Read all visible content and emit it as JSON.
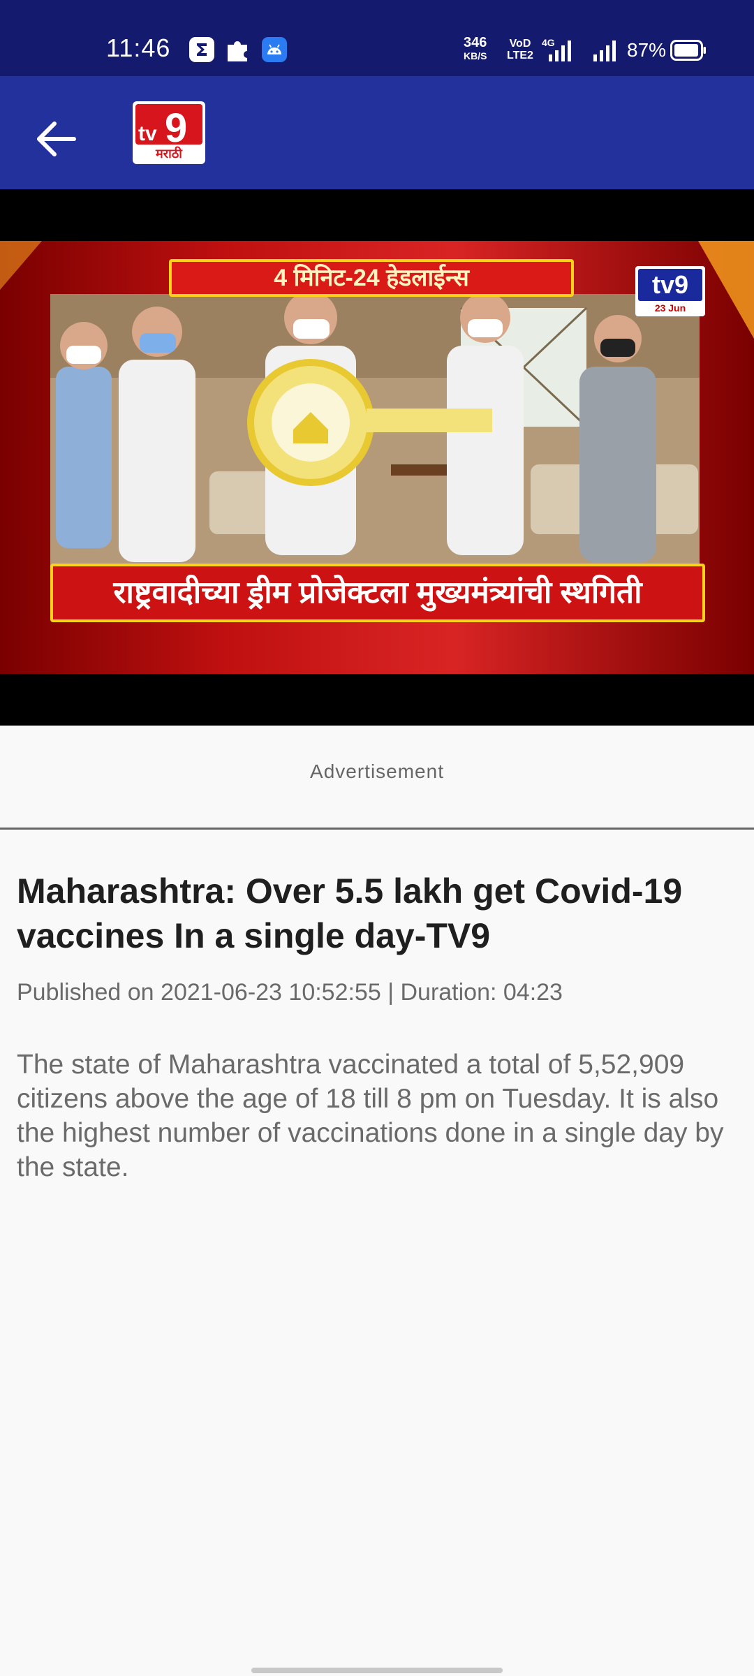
{
  "status_bar": {
    "time": "11:46",
    "net_speed_value": "346",
    "net_speed_unit": "KB/S",
    "volte_line1": "VoD",
    "volte_line2": "LTE2",
    "network_type": "4G",
    "battery_percent": "87%",
    "icons": [
      "sigma-icon",
      "puzzle-icon",
      "android-icon",
      "signal-icon",
      "signal-icon",
      "battery-icon"
    ]
  },
  "app_bar": {
    "back_icon": "arrow-left-icon",
    "logo_text": "9",
    "logo_prefix": "tv",
    "logo_subtext": "मराठी",
    "colors": {
      "background": "#23319c",
      "status_background": "#141a6e",
      "logo_red": "#d7151d"
    }
  },
  "video": {
    "headline_top": "4 मिनिट-24 हेडलाईन्स",
    "headline_bottom": "राष्ट्रवादीच्या ड्रीम प्रोजेक्टला मुख्यमंत्र्यांची स्थगिती",
    "logo_text": "tv9",
    "logo_date": "23 Jun"
  },
  "ad": {
    "label": "Advertisement"
  },
  "article": {
    "title": "Maharashtra: Over 5.5 lakh get Covid-19 vaccines In a single day-TV9",
    "meta": "Published on 2021-06-23 10:52:55 | Duration: 04:23",
    "summary": "The state of Maharashtra vaccinated a total of 5,52,909 citizens above the age of 18 till 8 pm on Tuesday. It is also the highest number of vaccinations done in a single day by the state."
  }
}
